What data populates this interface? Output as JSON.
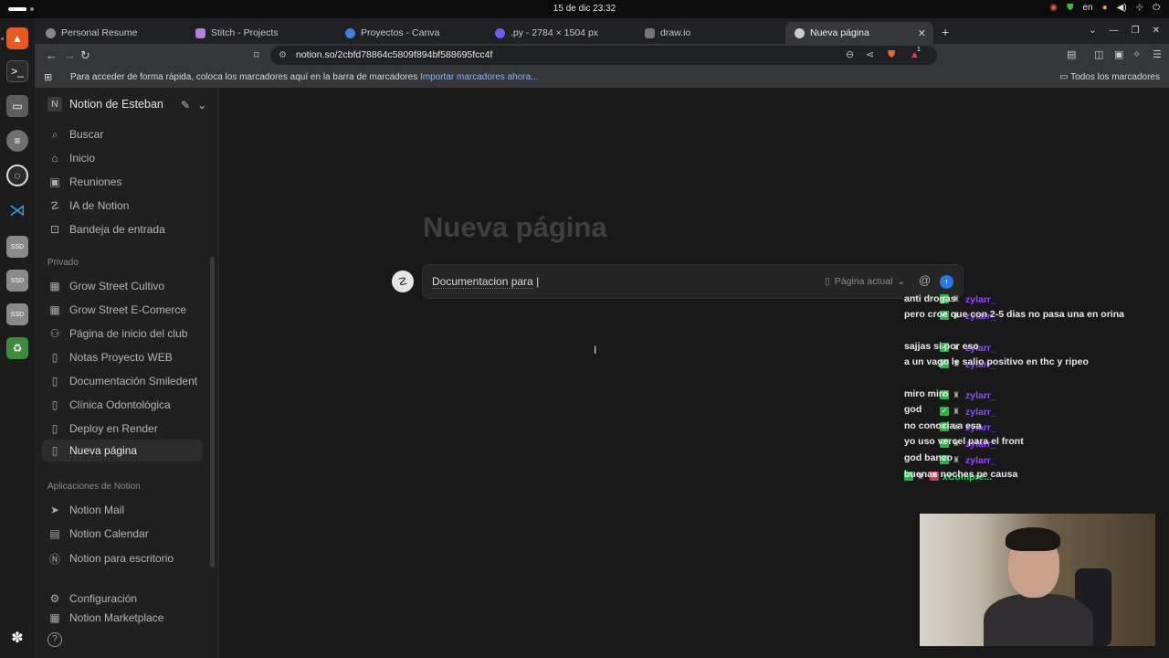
{
  "system": {
    "clock": "15 de dic  23:32",
    "keyboard": "en"
  },
  "browser": {
    "tabs": [
      {
        "label": "Personal Resume",
        "color": "#cccccc"
      },
      {
        "label": "Stitch - Projects",
        "color": "#b57edc"
      },
      {
        "label": "Proyectos - Canva",
        "color": "#3f7fe0"
      },
      {
        "label": ".py - 2784 × 1504 px",
        "color": "#3f7fe0"
      },
      {
        "label": "draw.io",
        "color": "#bbbbbb"
      },
      {
        "label": "Nueva página",
        "color": "#cccccc"
      }
    ],
    "url": "notion.so/2cbfd78864c5809f894bf588695fcc4f",
    "bookmark_msg": "Para acceder de forma rápida, coloca los marcadores aquí en la barra de marcadores",
    "bookmark_link": "Importar marcadores ahora...",
    "all_bookmarks": "Todos los marcadores",
    "shields_badge": "1"
  },
  "sidebar": {
    "workspace_initial": "N",
    "workspace": "Notion de Esteban",
    "top_items": [
      {
        "label": "Buscar",
        "icon": "search-icon"
      },
      {
        "label": "Inicio",
        "icon": "home-icon"
      },
      {
        "label": "Reuniones",
        "icon": "meetings-icon"
      },
      {
        "label": "IA de Notion",
        "icon": "ai-icon"
      },
      {
        "label": "Bandeja de entrada",
        "icon": "inbox-icon"
      }
    ],
    "private_label": "Privado",
    "private_items": [
      {
        "label": "Grow Street Cultivo",
        "icon": "page-image-icon"
      },
      {
        "label": "Grow Street E-Comerce",
        "icon": "page-image-icon"
      },
      {
        "label": "Página de inicio del club",
        "icon": "people-icon"
      },
      {
        "label": "Notas Proyecto WEB",
        "icon": "page-icon"
      },
      {
        "label": "Documentación Smiledent",
        "icon": "page-icon"
      },
      {
        "label": "Clínica Odontológica",
        "icon": "page-icon"
      },
      {
        "label": "Deploy en Render",
        "icon": "page-icon"
      },
      {
        "label": "Nueva página",
        "icon": "page-icon"
      }
    ],
    "apps_label": "Aplicaciones de Notion",
    "apps_items": [
      {
        "label": "Notion Mail",
        "icon": "mail-icon"
      },
      {
        "label": "Notion Calendar",
        "icon": "calendar-icon"
      },
      {
        "label": "Notion para escritorio",
        "icon": "desktop-icon"
      }
    ],
    "settings": "Configuración",
    "marketplace": "Notion Marketplace"
  },
  "page": {
    "title": "Nueva página",
    "ai_input": "Documentacion para",
    "ai_context": "Página actual"
  },
  "chat": {
    "messages": [
      {
        "user": "zylarr_",
        "text": "anti drogas"
      },
      {
        "user": "zylarr_",
        "text": "pero croe que con 2-5 dias no pasa una en orina"
      },
      {
        "user": "zylarr_",
        "text": "sajjas si por eso"
      },
      {
        "user": "zylarr_",
        "text": "a un vago le salio positivo en thc y ripeo"
      },
      {
        "user": "zylarr_",
        "text": "miro miro"
      },
      {
        "user": "zylarr_",
        "text": "god"
      },
      {
        "user": "zylarr_",
        "text": "no conocia a esa"
      },
      {
        "user": "zylarr_",
        "text": "yo uso vercel para el front"
      },
      {
        "user": "zylarr_",
        "text": "god banco"
      },
      {
        "user": "xCompre...",
        "text": "buenas noches pe causa"
      }
    ]
  }
}
